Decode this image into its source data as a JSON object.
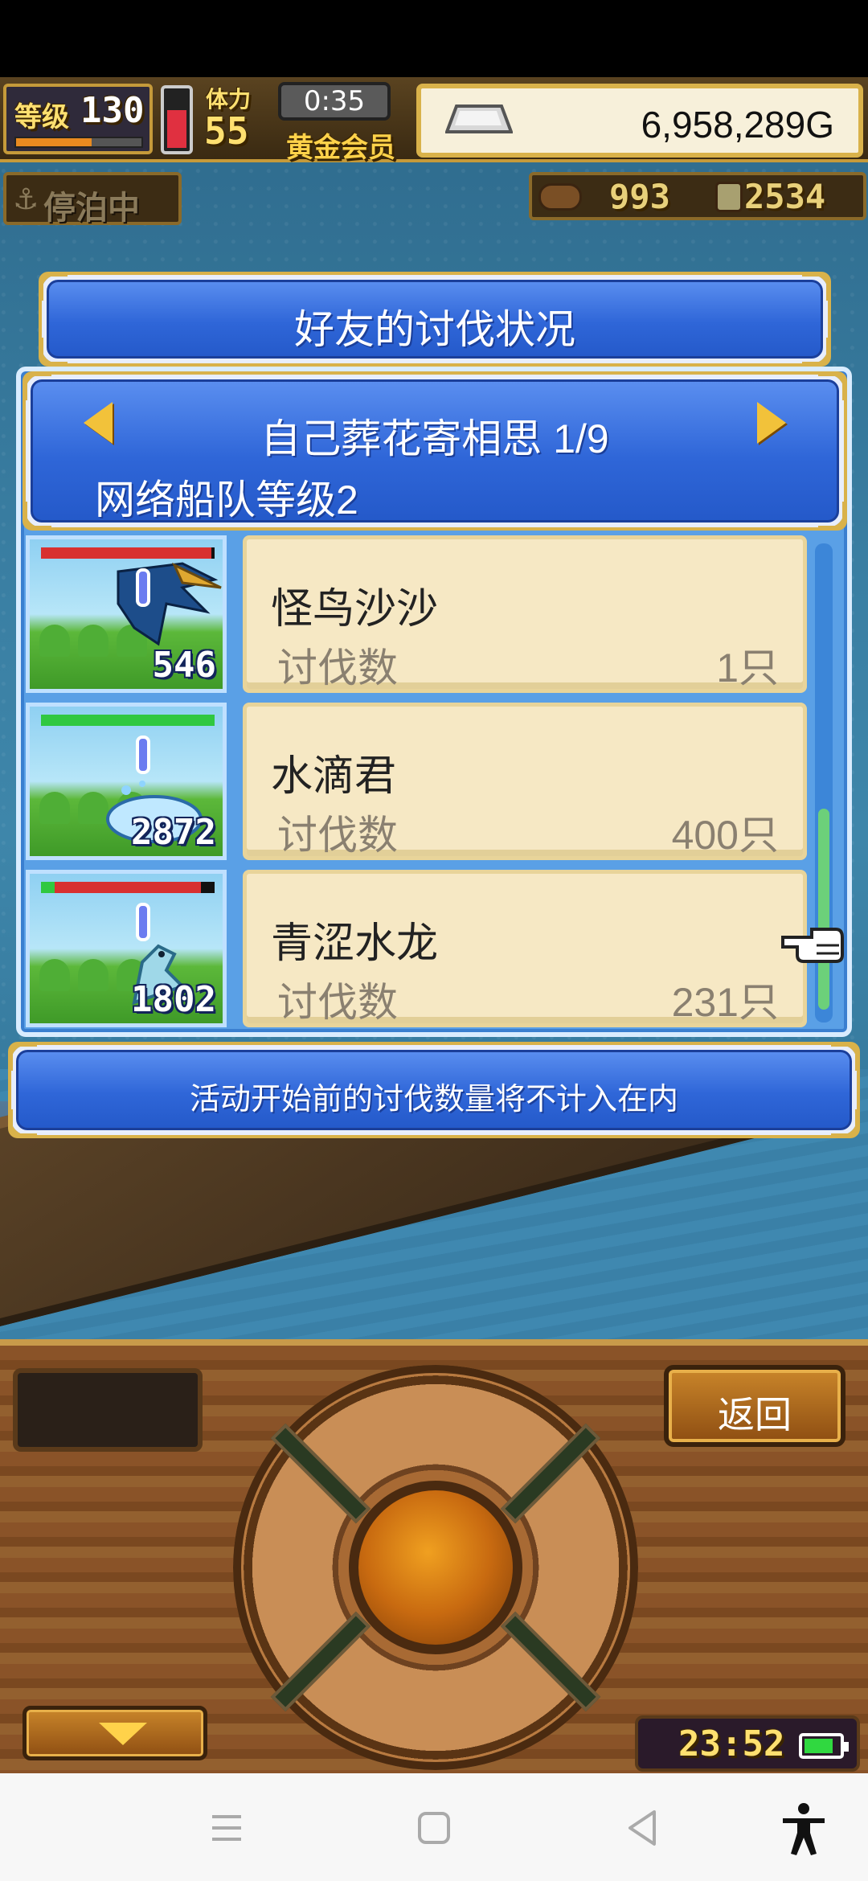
{
  "status": {
    "level_label": "等级",
    "level": "130",
    "exp_fraction": 0.6,
    "stamina_label": "体力",
    "stamina": "55",
    "stamina_fraction": 0.7,
    "timer": "0:35",
    "membership": "黄金会员",
    "gold": "6,958,289G",
    "docked_label": "停泊中",
    "wood": "993",
    "ore": "2534"
  },
  "dialog": {
    "title": "好友的讨伐状况",
    "friend_name": "自己葬花寄相思 1/9",
    "fleet_level": "网络船队等级2",
    "notice": "活动开始前的讨伐数量将不计入在内"
  },
  "monsters": [
    {
      "name": "怪鸟沙沙",
      "kill_label": "讨伐数",
      "kills": "1只",
      "count": "546",
      "hp_fraction": 0.98,
      "hp_color": "#d83030"
    },
    {
      "name": "水滴君",
      "kill_label": "讨伐数",
      "kills": "400只",
      "count": "2872",
      "hp_fraction": 1.0,
      "hp_color": "#30c840"
    },
    {
      "name": "青涩水龙",
      "kill_label": "讨伐数",
      "kills": "231只",
      "count": "1802",
      "hp_fraction": 0.92,
      "hp_color": "#d83030",
      "hp_low_color": "#30c840"
    }
  ],
  "controls": {
    "back_label": "返回",
    "clock": "23:52",
    "battery_fraction": 0.85
  },
  "colors": {
    "panel_blue": "#2f66d8",
    "gold_trim": "#d9b24a",
    "card_bg": "#f6e8c4"
  },
  "icons": {
    "anchor": "anchor-icon",
    "gold": "silver-ingot-icon",
    "wood": "wood-log-icon",
    "ore": "ore-icon",
    "prev": "left-arrow-icon",
    "next": "right-arrow-icon",
    "pointer": "pointing-hand-icon"
  }
}
